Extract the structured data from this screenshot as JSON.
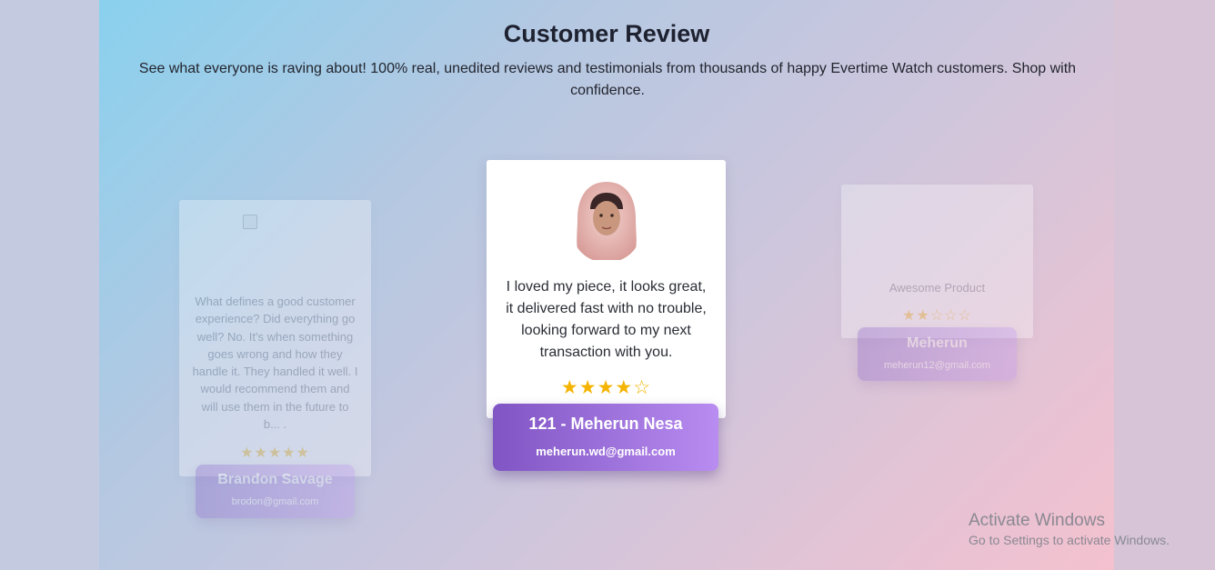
{
  "header": {
    "title": "Customer Review",
    "subtitle": "See what everyone is raving about! 100% real, unedited reviews and testimonials from thousands of happy Evertime Watch customers. Shop with confidence."
  },
  "reviews": [
    {
      "position": "left",
      "text": "What defines a good customer experience? Did everything go well? No. It's when something goes wrong and how they handle it. They handled it well. I would recommend them and will use them in the future to b... .",
      "rating": 5,
      "stars": "★★★★★",
      "name": "Brandon Savage",
      "email": "brodon@gmail.com"
    },
    {
      "position": "center",
      "text": "I loved my piece, it looks great, it delivered fast with no trouble, looking forward to my next transaction with you.",
      "rating": 4,
      "stars": "★★★★☆",
      "name": "121 - Meherun Nesa",
      "email": "meherun.wd@gmail.com"
    },
    {
      "position": "right",
      "text": "Awesome Product",
      "rating": 2,
      "stars": "★★☆☆☆",
      "name": "Meherun",
      "email": "meherun12@gmail.com"
    }
  ],
  "overlay": {
    "line1": "Activate Windows",
    "line2": "Go to Settings to activate Windows."
  },
  "colors": {
    "star": "#f4b400",
    "name_box_start": "#8055c4",
    "name_box_end": "#b88cf0"
  }
}
